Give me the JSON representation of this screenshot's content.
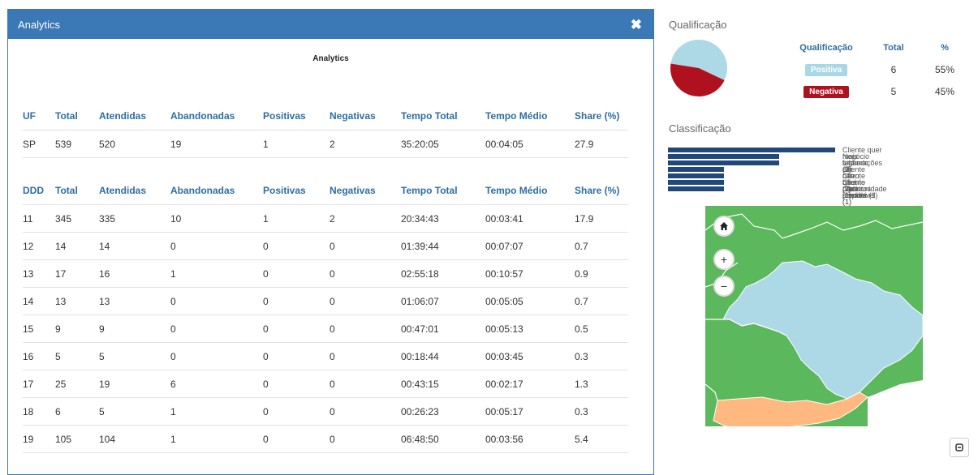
{
  "modal": {
    "title": "Analytics",
    "close_icon": "close-icon",
    "inner_title": "Analytics"
  },
  "uf_table": {
    "headers": [
      "UF",
      "Total",
      "Atendidas",
      "Abandonadas",
      "Positivas",
      "Negativas",
      "Tempo Total",
      "Tempo Médio",
      "Share (%)"
    ],
    "rows": [
      [
        "SP",
        "539",
        "520",
        "19",
        "1",
        "2",
        "35:20:05",
        "00:04:05",
        "27.9"
      ]
    ]
  },
  "ddd_table": {
    "headers": [
      "DDD",
      "Total",
      "Atendidas",
      "Abandonadas",
      "Positivas",
      "Negativas",
      "Tempo Total",
      "Tempo Médio",
      "Share (%)"
    ],
    "rows": [
      [
        "11",
        "345",
        "335",
        "10",
        "1",
        "2",
        "20:34:43",
        "00:03:41",
        "17.9"
      ],
      [
        "12",
        "14",
        "14",
        "0",
        "0",
        "0",
        "01:39:44",
        "00:07:07",
        "0.7"
      ],
      [
        "13",
        "17",
        "16",
        "1",
        "0",
        "0",
        "02:55:18",
        "00:10:57",
        "0.9"
      ],
      [
        "14",
        "13",
        "13",
        "0",
        "0",
        "0",
        "01:06:07",
        "00:05:05",
        "0.7"
      ],
      [
        "15",
        "9",
        "9",
        "0",
        "0",
        "0",
        "00:47:01",
        "00:05:13",
        "0.5"
      ],
      [
        "16",
        "5",
        "5",
        "0",
        "0",
        "0",
        "00:18:44",
        "00:03:45",
        "0.3"
      ],
      [
        "17",
        "25",
        "19",
        "6",
        "0",
        "0",
        "00:43:15",
        "00:02:17",
        "1.3"
      ],
      [
        "18",
        "6",
        "5",
        "1",
        "0",
        "0",
        "00:26:23",
        "00:05:17",
        "0.3"
      ],
      [
        "19",
        "105",
        "104",
        "1",
        "0",
        "0",
        "06:48:50",
        "00:03:56",
        "5.4"
      ]
    ]
  },
  "qualificacao": {
    "title": "Qualificação",
    "headers": [
      "Qualificação",
      "Total",
      "%"
    ],
    "rows": [
      {
        "label": "Positiva",
        "total": "6",
        "pct": "55%",
        "color": "#a8d8e6"
      },
      {
        "label": "Negativa",
        "total": "5",
        "pct": "45%",
        "color": "#b0111e"
      }
    ],
    "pie": [
      {
        "label": "Positiva",
        "value": 6,
        "color": "#add8e6"
      },
      {
        "label": "Negativa",
        "value": 5,
        "color": "#b0111e"
      }
    ]
  },
  "classificacao": {
    "title": "Classificação",
    "bar_color": "#22487a",
    "items": [
      {
        "label": "Cliente quer mais informações (3)",
        "value": 3
      },
      {
        "label": "Negócio fechado (2)",
        "value": 2
      },
      {
        "label": "Ligar em outro horário (2)",
        "value": 2
      },
      {
        "label": "Cliente não quer produtos (1)",
        "value": 1
      },
      {
        "label": "Cliente não pôde atender (1)",
        "value": 1
      },
      {
        "label": "Cliente não disponível (1)",
        "value": 1
      },
      {
        "label": "Oportunidade perdida (1)",
        "value": 1
      }
    ]
  },
  "map": {
    "home_icon": "home-icon",
    "zoom_in_icon": "plus-icon",
    "zoom_out_icon": "minus-icon",
    "colors": {
      "sp": "#add8e6",
      "neighbors": "#5cb85c",
      "south": "#ffb880"
    }
  },
  "corner_icon": "collapse-icon"
}
